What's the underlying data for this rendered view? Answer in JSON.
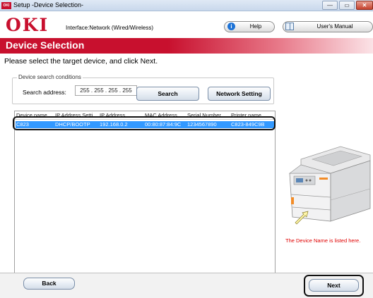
{
  "window": {
    "app_icon_text": "OKI",
    "title": "Setup -Device Selection-",
    "controls": {
      "minimize": "—",
      "maximize": "▭",
      "close": "✕"
    }
  },
  "header": {
    "logo": "OKI",
    "interface_label": "Interface:Network (Wired/Wireless)",
    "help_label": "Help",
    "manual_label": "User's Manual"
  },
  "section_title": "Device Selection",
  "instruction": "Please select the target device, and click Next.",
  "search": {
    "group_label": "Device search conditions",
    "address_label": "Search address:",
    "address_value": "255 . 255 . 255 . 255",
    "search_button": "Search",
    "network_setting_button": "Network Setting"
  },
  "device_list": {
    "columns": [
      "Device name",
      "IP Address Setti",
      "IP Address",
      "MAC Address",
      "Serial Number",
      "Printer name"
    ],
    "rows": [
      [
        "C823",
        "DHCP/BOOTP",
        "192.168.0.2",
        "00:80:87:84:9C",
        "1234567890",
        "C823-849C9B"
      ]
    ]
  },
  "side_caption": "The Device Name is listed here.",
  "footer": {
    "back_button": "Back",
    "next_button": "Next"
  },
  "colors": {
    "brand_red": "#c8102e",
    "selection_blue": "#3399ff",
    "caption_red": "#e00000"
  }
}
